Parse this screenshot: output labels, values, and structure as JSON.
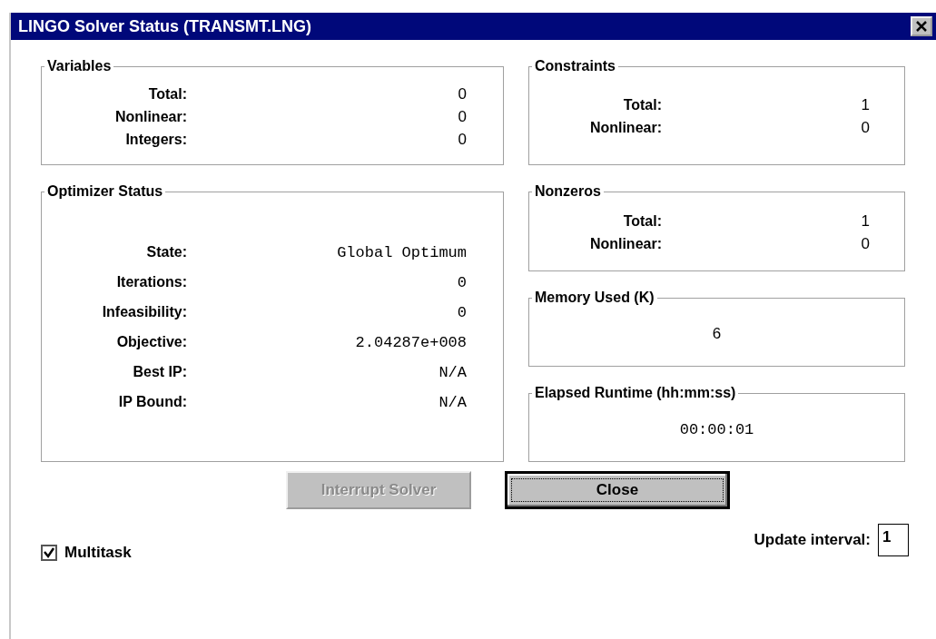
{
  "window": {
    "title": "LINGO Solver Status (TRANSMT.LNG)"
  },
  "left_groups": [
    {
      "title": "Variables",
      "kind": "list",
      "rows": [
        {
          "label": "Total:",
          "value": "0"
        },
        {
          "label": "Nonlinear:",
          "value": "0"
        },
        {
          "label": "Integers:",
          "value": "0"
        }
      ]
    },
    {
      "title": "Optimizer Status",
      "kind": "mono-list",
      "rows": [
        {
          "label": "State:",
          "value": "Global Optimum"
        },
        {
          "label": "Iterations:",
          "value": "0"
        },
        {
          "label": "Infeasibility:",
          "value": "0"
        },
        {
          "label": "Objective:",
          "value": "2.04287e+008"
        },
        {
          "label": "Best IP:",
          "value": "N/A"
        },
        {
          "label": "IP Bound:",
          "value": "N/A"
        }
      ]
    }
  ],
  "right_groups": [
    {
      "title": "Constraints",
      "kind": "list",
      "rows": [
        {
          "label": "Total:",
          "value": "1"
        },
        {
          "label": "Nonlinear:",
          "value": "0"
        }
      ]
    },
    {
      "title": "Nonzeros",
      "kind": "list",
      "rows": [
        {
          "label": "Total:",
          "value": "1"
        },
        {
          "label": "Nonlinear:",
          "value": "0"
        }
      ]
    },
    {
      "title": "Memory Used (K)",
      "kind": "single",
      "value": "6"
    },
    {
      "title": "Elapsed Runtime (hh:mm:ss)",
      "kind": "mono-single",
      "value": "00:00:01"
    }
  ],
  "buttons": [
    {
      "label": "Interrupt Solver",
      "disabled": true,
      "default": false
    },
    {
      "label": "Close",
      "disabled": false,
      "default": true
    }
  ],
  "multitask": {
    "label": "Multitask",
    "checked": true
  },
  "update_interval": {
    "label": "Update interval:",
    "value": "1"
  }
}
